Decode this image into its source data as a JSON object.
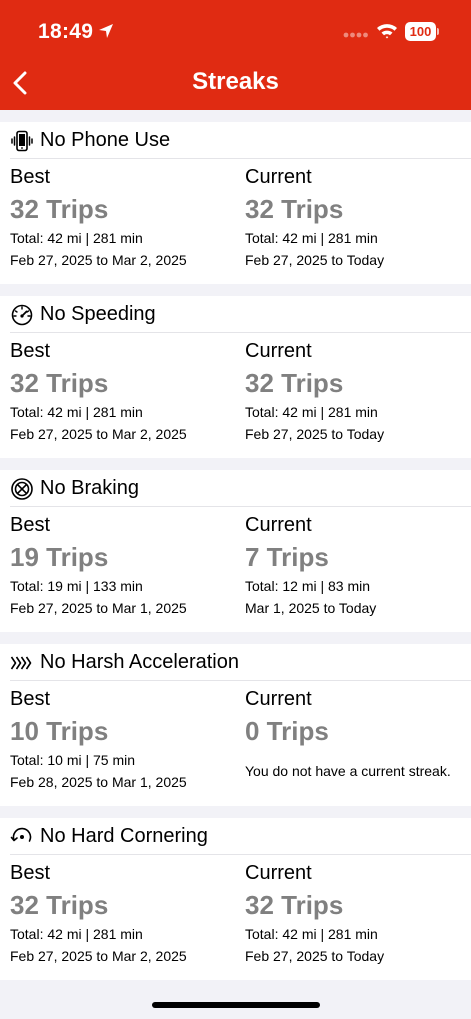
{
  "status_bar": {
    "time": "18:49",
    "battery": "100"
  },
  "nav": {
    "title": "Streaks"
  },
  "labels": {
    "best": "Best",
    "current": "Current"
  },
  "streaks": [
    {
      "title": "No Phone Use",
      "icon": "phone-vibrate-icon",
      "best": {
        "trips": "32 Trips",
        "total": "Total: 42 mi | 281 min",
        "dates": "Feb 27, 2025 to Mar 2, 2025"
      },
      "current": {
        "trips": "32 Trips",
        "total": "Total: 42 mi | 281 min",
        "dates": "Feb 27, 2025 to Today"
      }
    },
    {
      "title": "No Speeding",
      "icon": "speedometer-icon",
      "best": {
        "trips": "32 Trips",
        "total": "Total: 42 mi | 281 min",
        "dates": "Feb 27, 2025 to Mar 2, 2025"
      },
      "current": {
        "trips": "32 Trips",
        "total": "Total: 42 mi | 281 min",
        "dates": "Feb 27, 2025 to Today"
      }
    },
    {
      "title": "No Braking",
      "icon": "brake-disc-icon",
      "best": {
        "trips": "19 Trips",
        "total": "Total: 19 mi | 133 min",
        "dates": "Feb 27, 2025 to Mar 1, 2025"
      },
      "current": {
        "trips": "7 Trips",
        "total": "Total: 12 mi | 83 min",
        "dates": "Mar 1, 2025 to Today"
      }
    },
    {
      "title": "No Harsh Acceleration",
      "icon": "acceleration-chevrons-icon",
      "best": {
        "trips": "10 Trips",
        "total": "Total: 10 mi | 75 min",
        "dates": "Feb 28, 2025 to Mar 1, 2025"
      },
      "current": {
        "trips": "0 Trips",
        "message": "You do not have a current streak."
      }
    },
    {
      "title": "No Hard Cornering",
      "icon": "cornering-arrow-icon",
      "best": {
        "trips": "32 Trips",
        "total": "Total: 42 mi | 281 min",
        "dates": "Feb 27, 2025 to Mar 2, 2025"
      },
      "current": {
        "trips": "32 Trips",
        "total": "Total: 42 mi | 281 min",
        "dates": "Feb 27, 2025 to Today"
      }
    }
  ]
}
